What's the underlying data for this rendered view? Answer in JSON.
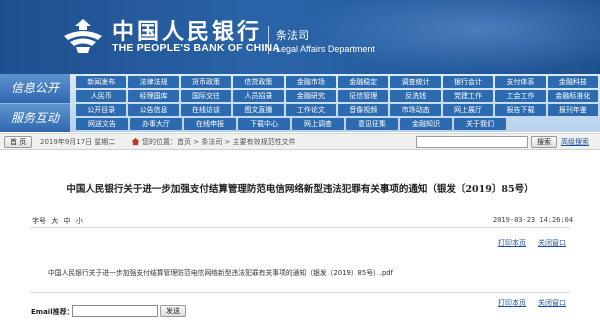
{
  "header": {
    "logo_cn": "中国人民银行",
    "logo_en": "THE PEOPLE'S BANK OF CHINA",
    "dept_cn": "条法司",
    "dept_en": "Legal Affairs Department"
  },
  "nav": {
    "section1_label": "信息公开",
    "section2_label": "服务互动",
    "rows": [
      [
        "新闻发布",
        "法律法规",
        "货币政策",
        "信贷政策",
        "金融市场",
        "金融稳定",
        "调查统计",
        "银行会计",
        "支付体系",
        "金融科技"
      ],
      [
        "人民币",
        "经理国库",
        "国际交往",
        "人员招录",
        "金融研究",
        "征信管理",
        "反洗钱",
        "党建工作",
        "工会工作",
        "金融标准化"
      ],
      [
        "公开目录",
        "公告信息",
        "在线访谈",
        "图文直播",
        "工作论文",
        "音像视频",
        "市场动态",
        "网上展厅",
        "报告下载",
        "报刊年鉴"
      ],
      [
        "网送文告",
        "办事大厅",
        "在线申报",
        "下载中心",
        "网上调查",
        "意见征集",
        "金融知识",
        "关于我们"
      ]
    ]
  },
  "toolbar": {
    "home_label": "首 页",
    "date": "2019年9月17日 星期二",
    "breadcrumb": "您的位置：首页  >  条法司  >  主要有效规范性文件",
    "search_value": "",
    "search_button": "搜索",
    "advanced_search": "高级搜索"
  },
  "article": {
    "title": "中国人民银行关于进一步加强支付结算管理防范电信网络新型违法犯罪有关事项的通知（银发〔2019〕85号）",
    "font_size_label": "字号",
    "font_sizes": [
      "大",
      "中",
      "小"
    ],
    "date": "2019-03-23 14:26:04",
    "print_label": "打印本页",
    "close_label": "关闭窗口",
    "attachment": "中国人民银行关于进一步加强支付结算管理防范电信网络新型违法犯罪有关事项的通知（银发〔2019〕85号）.pdf",
    "email_label": "Email推荐：",
    "email_value": "",
    "send_label": "发送"
  },
  "colors": {
    "banner": "#2a64a8",
    "nav_item": "#2d6bb0",
    "link": "#1a4fa0"
  }
}
